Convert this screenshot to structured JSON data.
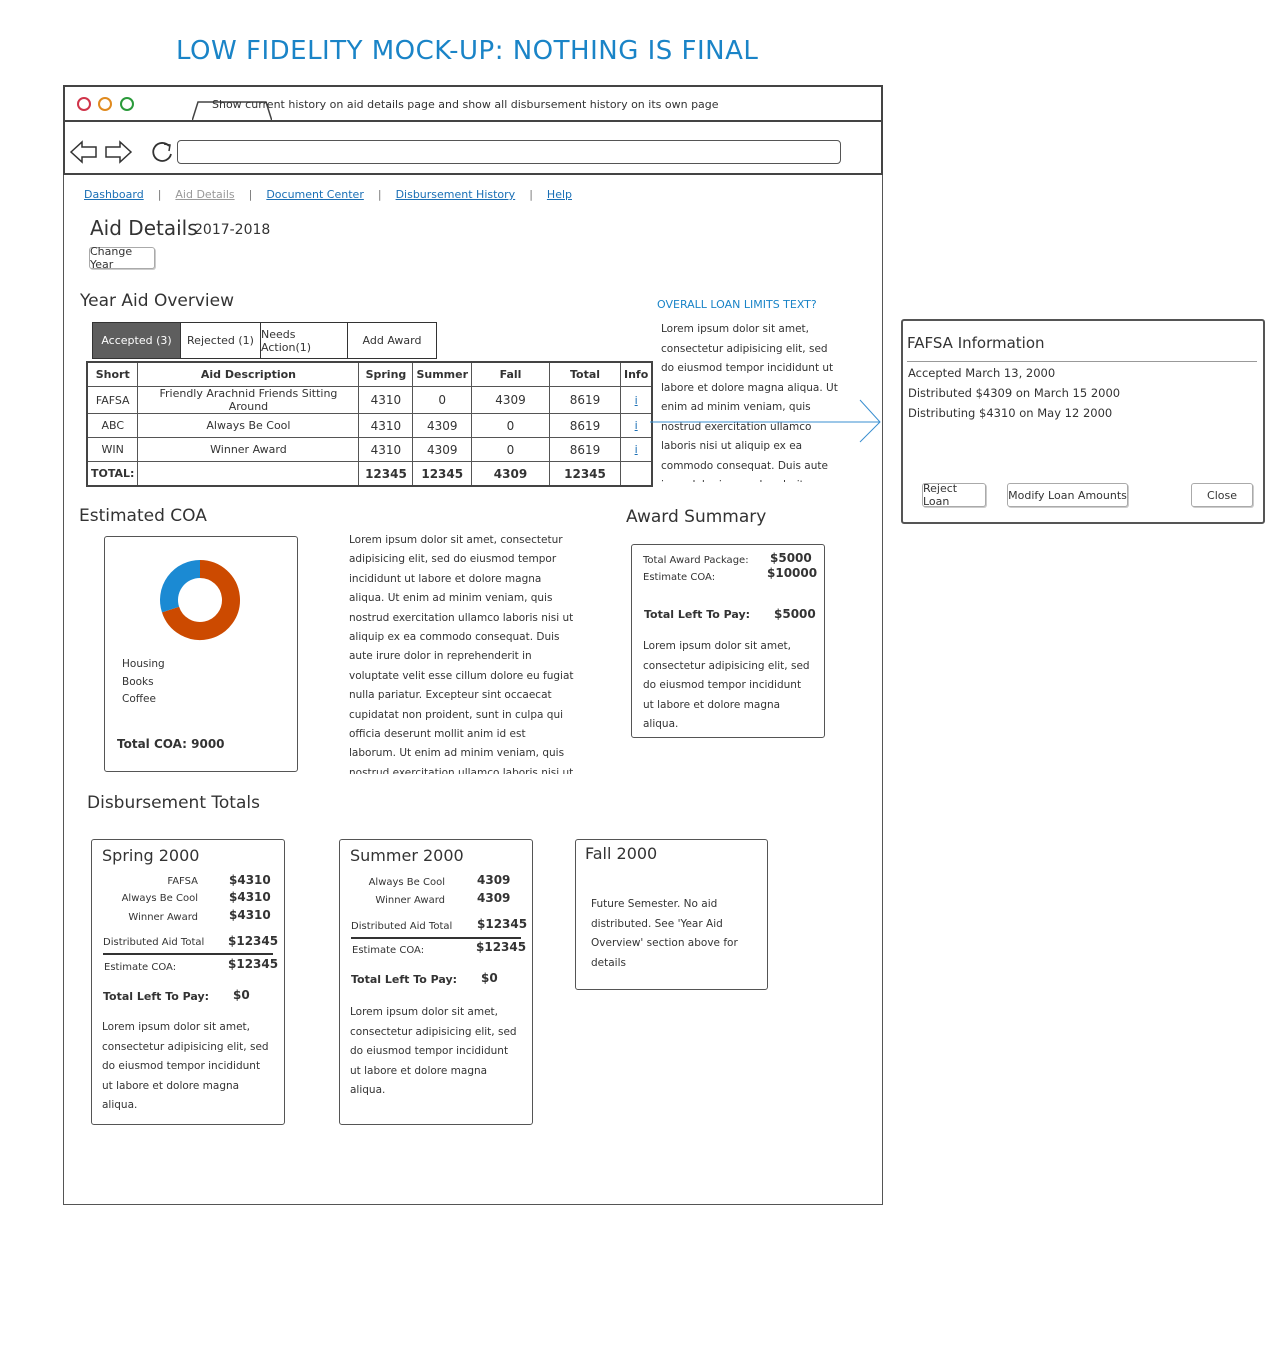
{
  "banner": "LOW FIDELITY MOCK-UP: NOTHING IS FINAL",
  "browser": {
    "tab_title": "Show current history on aid details page and show all disbursement history on its own page"
  },
  "nav": {
    "dashboard": "Dashboard",
    "aid_details": "Aid Details",
    "document_center": "Document Center",
    "disbursement_history": "Disbursement History",
    "help": "Help"
  },
  "page": {
    "title": "Aid Details",
    "year": "2017-2018",
    "change_year": "Change Year"
  },
  "overview": {
    "heading": "Year Aid Overview",
    "tabs": [
      "Accepted (3)",
      "Rejected (1)",
      "Needs Action(1)",
      "Add Award"
    ],
    "columns": [
      "Short",
      "Aid Description",
      "Spring",
      "Summer",
      "Fall",
      "Total",
      "Info"
    ],
    "rows": [
      {
        "short": "FAFSA",
        "desc": "Friendly Arachnid Friends Sitting Around",
        "spring": "4310",
        "summer": "0",
        "fall": "4309",
        "total": "8619",
        "info": "i"
      },
      {
        "short": "ABC",
        "desc": "Always Be Cool",
        "spring": "4310",
        "summer": "4309",
        "fall": "0",
        "total": "8619",
        "info": "i"
      },
      {
        "short": "WIN",
        "desc": "Winner Award",
        "spring": "4310",
        "summer": "4309",
        "fall": "0",
        "total": "8619",
        "info": "i"
      }
    ],
    "total_row": {
      "label": "TOTAL:",
      "spring": "12345",
      "summer": "12345",
      "fall": "4309",
      "total": "12345"
    }
  },
  "loan_limits": {
    "link": "OVERALL LOAN LIMITS TEXT?",
    "text": "Lorem ipsum dolor sit amet, consectetur adipisicing elit, sed do eiusmod tempor incididunt ut labore et dolore magna aliqua. Ut enim ad minim veniam, quis nostrud exercitation ullamco laboris nisi ut aliquip ex ea commodo consequat. Duis aute irure dolor in reprehenderit"
  },
  "fafsa": {
    "title": "FAFSA Information",
    "accepted": "Accepted March 13, 2000",
    "distributed": "Distributed $4309 on March 15 2000",
    "distributing": "Distributing $4310 on May 12 2000",
    "reject_button": "Reject Loan",
    "modify_button": "Modify Loan Amounts",
    "close_button": "Close"
  },
  "coa": {
    "heading": "Estimated COA",
    "legend": [
      "Housing",
      "Books",
      "Coffee"
    ],
    "total": "Total COA: 9000",
    "colors": {
      "blue": "#1b8ad3",
      "orange": "#cc4a00"
    }
  },
  "chart_data": {
    "type": "pie",
    "categories": [
      "Housing",
      "Books",
      "Coffee"
    ],
    "values": [
      70,
      30,
      0
    ],
    "colors": [
      "#cc4a00",
      "#1b8ad3",
      "#888888"
    ]
  },
  "middle_text": "Lorem ipsum dolor sit amet, consectetur adipisicing elit, sed do eiusmod tempor incididunt ut labore et dolore magna aliqua. Ut enim ad minim veniam, quis nostrud exercitation ullamco laboris nisi ut aliquip ex ea commodo consequat. Duis aute irure dolor in reprehenderit in voluptate velit esse cillum dolore eu fugiat nulla pariatur. Excepteur sint occaecat cupidatat non proident, sunt in culpa qui officia deserunt mollit anim id est laborum. Ut enim ad minim veniam, quis nostrud exercitation ullamco laboris nisi ut",
  "award_summary": {
    "heading": "Award Summary",
    "package_label": "Total Award Package:",
    "package_value": "$5000",
    "coa_label": "Estimate COA:",
    "coa_value": "$10000",
    "left_label": "Total Left To Pay:",
    "left_value": "$5000",
    "text": "Lorem ipsum dolor sit amet, consectetur adipisicing elit, sed do eiusmod tempor incididunt ut labore et dolore magna aliqua."
  },
  "disbursement": {
    "heading": "Disbursement Totals",
    "spring": {
      "title": "Spring 2000",
      "items": [
        {
          "label": "FAFSA",
          "value": "$4310"
        },
        {
          "label": "Always Be Cool",
          "value": "$4310"
        },
        {
          "label": "Winner Award",
          "value": "$4310"
        }
      ],
      "dist_label": "Distributed Aid Total",
      "dist_value": "$12345",
      "coa_label": "Estimate COA:",
      "coa_value": "$12345",
      "left_label": "Total Left To Pay:",
      "left_value": "$0",
      "text": "Lorem ipsum dolor sit amet, consectetur adipisicing elit, sed do eiusmod tempor incididunt ut labore et dolore magna aliqua."
    },
    "summer": {
      "title": "Summer 2000",
      "items": [
        {
          "label": "Always Be Cool",
          "value": "4309"
        },
        {
          "label": "Winner Award",
          "value": "4309"
        }
      ],
      "dist_label": "Distributed Aid Total",
      "dist_value": "$12345",
      "coa_label": "Estimate COA:",
      "coa_value": "$12345",
      "left_label": "Total Left To Pay:",
      "left_value": "$0",
      "text": "Lorem ipsum dolor sit amet, consectetur adipisicing elit, sed do eiusmod tempor incididunt ut labore et dolore magna aliqua."
    },
    "fall": {
      "title": "Fall 2000",
      "text": "Future Semester. No aid distributed. See 'Year Aid Overview' section above for details"
    }
  }
}
